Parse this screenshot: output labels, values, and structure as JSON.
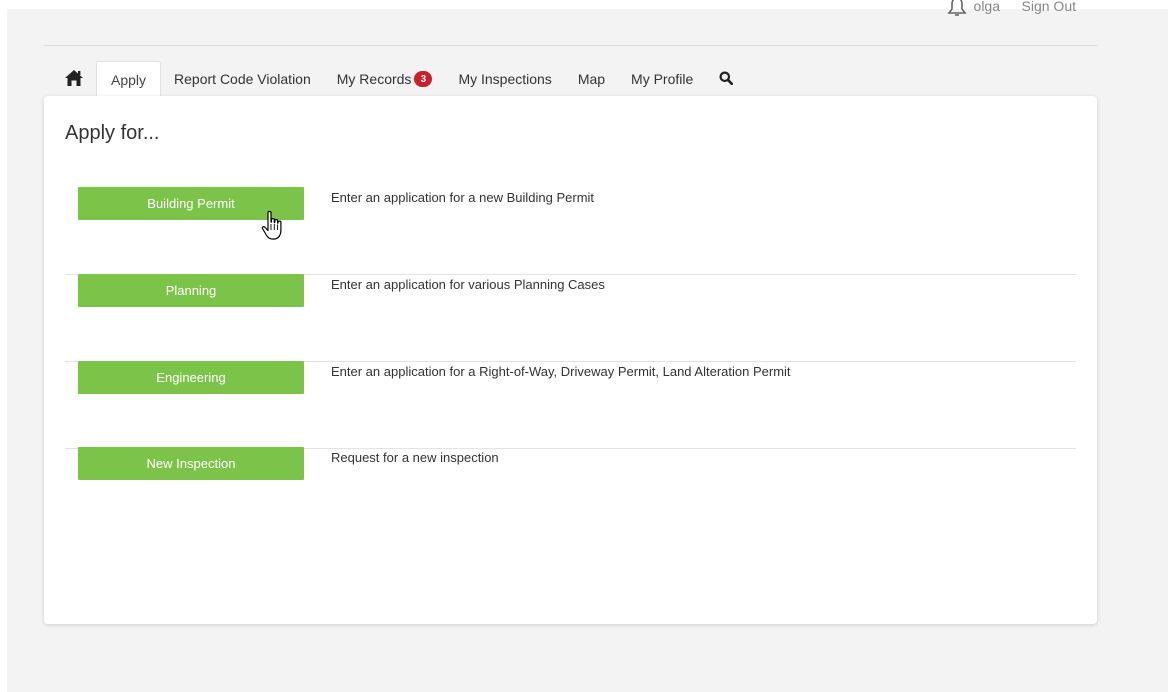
{
  "header": {
    "user_name": "olga",
    "sign_out_label": "Sign Out",
    "bell_icon": "bell-icon"
  },
  "tabs": [
    {
      "label": "",
      "icon": "home-icon"
    },
    {
      "label": "Apply",
      "active": true
    },
    {
      "label": "Report Code Violation"
    },
    {
      "label": "My Records",
      "badge": "3"
    },
    {
      "label": "My Inspections"
    },
    {
      "label": "Map"
    },
    {
      "label": "My Profile"
    },
    {
      "label": "",
      "icon": "search-icon"
    }
  ],
  "main": {
    "title": "Apply for...",
    "items": [
      {
        "button_label": "Building Permit",
        "description": "Enter an application for a new Building Permit"
      },
      {
        "button_label": "Planning",
        "description": "Enter an application for various Planning Cases"
      },
      {
        "button_label": "Engineering",
        "description": "Enter an application for a Right-of-Way, Driveway Permit, Land Alteration Permit"
      },
      {
        "button_label": "New Inspection",
        "description": "Request for a new inspection"
      }
    ]
  },
  "colors": {
    "button_green": "#7cc449",
    "badge_red": "#c9202c",
    "page_background": "#f3f3f3"
  }
}
